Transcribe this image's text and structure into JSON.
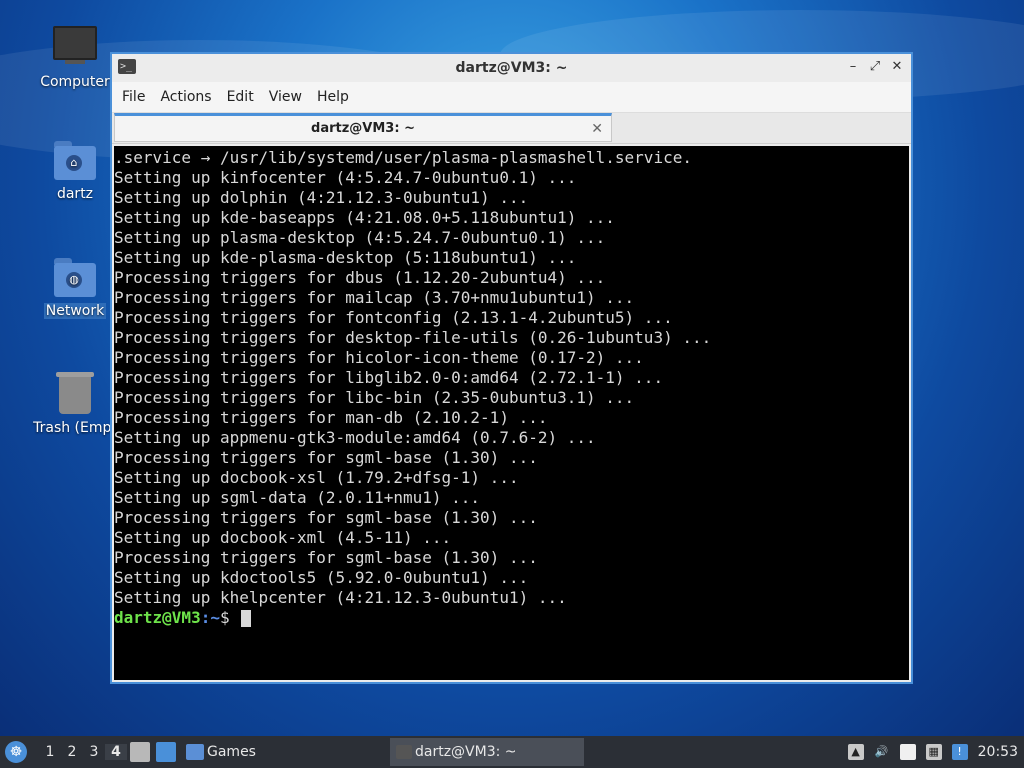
{
  "desktop": {
    "icons": [
      {
        "label": "Computer"
      },
      {
        "label": "dartz"
      },
      {
        "label": "Network"
      },
      {
        "label": "Trash (Empt"
      }
    ]
  },
  "window": {
    "title": "dartz@VM3: ~",
    "controls": {
      "minimize": "–",
      "maximize": "⤢",
      "close": "✕"
    },
    "menu": [
      "File",
      "Actions",
      "Edit",
      "View",
      "Help"
    ],
    "tab": {
      "label": "dartz@VM3: ~",
      "close": "✕"
    }
  },
  "terminal": {
    "lines": [
      ".service → /usr/lib/systemd/user/plasma-plasmashell.service.",
      "Setting up kinfocenter (4:5.24.7-0ubuntu0.1) ...",
      "Setting up dolphin (4:21.12.3-0ubuntu1) ...",
      "Setting up kde-baseapps (4:21.08.0+5.118ubuntu1) ...",
      "Setting up plasma-desktop (4:5.24.7-0ubuntu0.1) ...",
      "Setting up kde-plasma-desktop (5:118ubuntu1) ...",
      "Processing triggers for dbus (1.12.20-2ubuntu4) ...",
      "Processing triggers for mailcap (3.70+nmu1ubuntu1) ...",
      "Processing triggers for fontconfig (2.13.1-4.2ubuntu5) ...",
      "Processing triggers for desktop-file-utils (0.26-1ubuntu3) ...",
      "Processing triggers for hicolor-icon-theme (0.17-2) ...",
      "Processing triggers for libglib2.0-0:amd64 (2.72.1-1) ...",
      "Processing triggers for libc-bin (2.35-0ubuntu3.1) ...",
      "Processing triggers for man-db (2.10.2-1) ...",
      "Setting up appmenu-gtk3-module:amd64 (0.7.6-2) ...",
      "Processing triggers for sgml-base (1.30) ...",
      "Setting up docbook-xsl (1.79.2+dfsg-1) ...",
      "Setting up sgml-data (2.0.11+nmu1) ...",
      "Processing triggers for sgml-base (1.30) ...",
      "Setting up docbook-xml (4.5-11) ...",
      "Processing triggers for sgml-base (1.30) ...",
      "Setting up kdoctools5 (5.92.0-0ubuntu1) ...",
      "Setting up khelpcenter (4:21.12.3-0ubuntu1) ..."
    ],
    "prompt": {
      "user_host": "dartz@VM3",
      "path": ":~",
      "symbol": "$ "
    }
  },
  "taskbar": {
    "workspaces": [
      "1",
      "2",
      "3",
      "4"
    ],
    "active_workspace": "4",
    "launchers": [
      {
        "label": "Games"
      }
    ],
    "active_task": {
      "label": "dartz@VM3: ~"
    },
    "clock": "20:53"
  },
  "colors": {
    "accent": "#4a90d9",
    "prompt_user": "#6ee34a",
    "prompt_path": "#5b8ee6",
    "terminal_bg": "#000000",
    "taskbar_bg": "#2b2f36"
  }
}
